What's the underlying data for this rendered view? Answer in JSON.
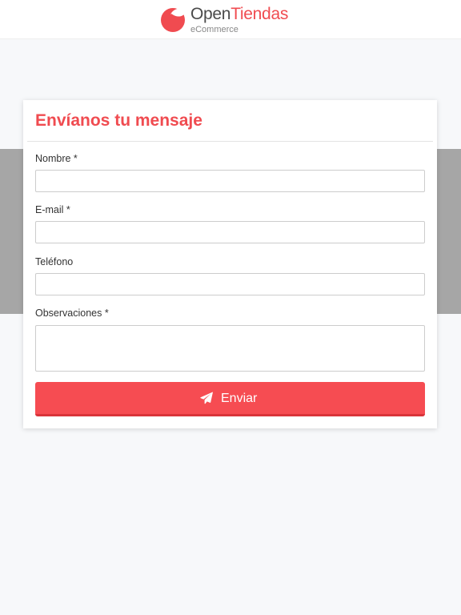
{
  "header": {
    "logo": {
      "name_part1": "Open",
      "name_part2": "Tiendas",
      "subtitle": "eCommerce",
      "mark_icon": "circle-bite-logo-icon"
    }
  },
  "colors": {
    "brand_red": "#f04b50",
    "button_red": "#f64c52",
    "band_gray": "#a6a6a6",
    "background": "#f7f8fa"
  },
  "form": {
    "title": "Envíanos tu mensaje",
    "fields": [
      {
        "label": "Nombre *",
        "value": "",
        "placeholder": ""
      },
      {
        "label": "E-mail *",
        "value": "",
        "placeholder": ""
      },
      {
        "label": "Teléfono",
        "value": "",
        "placeholder": ""
      },
      {
        "label": "Observaciones *",
        "value": "",
        "placeholder": ""
      }
    ],
    "submit": {
      "label": "Enviar",
      "icon": "paper-plane-icon"
    }
  }
}
